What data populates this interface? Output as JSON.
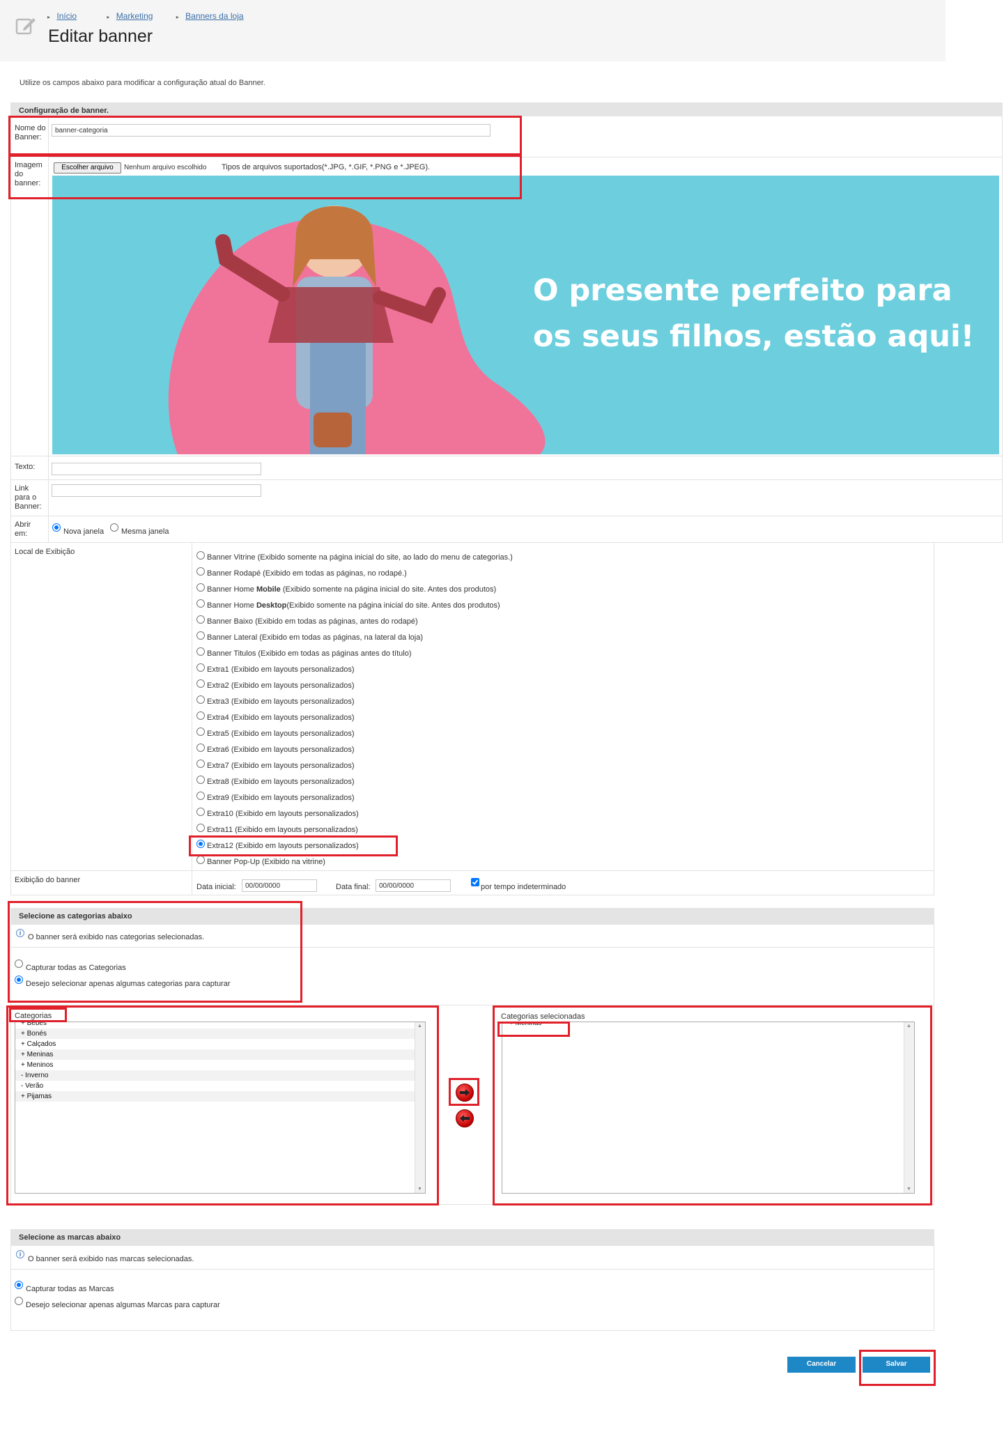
{
  "breadcrumb": [
    "Início",
    "Marketing",
    "Banners da loja"
  ],
  "page_title": "Editar banner",
  "intro": "Utilize os campos abaixo para modificar a configuração atual do Banner.",
  "config": {
    "header": "Configuração de banner.",
    "name_label": "Nome do Banner:",
    "name_value": "banner-categoria",
    "image_label": "Imagem do banner:",
    "choose_file": "Escolher arquivo",
    "no_file": "Nenhum arquivo escolhido",
    "file_types": "Tipos de arquivos suportados(*.JPG, *.GIF, *.PNG e *.JPEG).",
    "banner_headline_1": "O presente perfeito para",
    "banner_headline_2": "os seus filhos, estão aqui!",
    "text_label": "Texto:",
    "link_label": "Link para o Banner:",
    "open_label": "Abrir em:",
    "open_new": "Nova janela",
    "open_same": "Mesma janela",
    "display_label": "Local de Exibição",
    "display_options": [
      "Banner Vitrine (Exibido somente na página inicial do site, ao lado do menu de categorias.)",
      "Banner Rodapé (Exibido em todas as páginas, no rodapé.)",
      "Banner Home Mobile (Exibido somente na página inicial do site. Antes dos produtos)",
      "Banner Home Desktop(Exibido somente na página inicial do site. Antes dos produtos)",
      "Banner Baixo (Exibido em todas as páginas, antes do rodapé)",
      "Banner Lateral (Exibido em todas as páginas, na lateral da loja)",
      "Banner Titulos (Exibido em todas as páginas antes do título)",
      "Extra1 (Exibido em layouts personalizados)",
      "Extra2 (Exibido em layouts personalizados)",
      "Extra3 (Exibido em layouts personalizados)",
      "Extra4 (Exibido em layouts personalizados)",
      "Extra5 (Exibido em layouts personalizados)",
      "Extra6 (Exibido em layouts personalizados)",
      "Extra7 (Exibido em layouts personalizados)",
      "Extra8 (Exibido em layouts personalizados)",
      "Extra9 (Exibido em layouts personalizados)",
      "Extra10 (Exibido em layouts personalizados)",
      "Extra11 (Exibido em layouts personalizados)",
      "Extra12 (Exibido em layouts personalizados)",
      "Banner Pop-Up (Exibido na vitrine)"
    ],
    "display_selected_index": 18,
    "period_label": "Exibição do banner",
    "start_label": "Data inicial:",
    "start_value": "00/00/0000",
    "end_label": "Data final:",
    "end_value": "00/00/0000",
    "indefinite": "por tempo indeterminado"
  },
  "categories": {
    "header": "Selecione as categorias abaixo",
    "info": "O banner será exibido nas categorias selecionadas.",
    "all": "Capturar todas as Categorias",
    "some": "Desejo selecionar apenas algumas categorias para capturar",
    "list_label": "Categorias",
    "items": [
      "+ Bebes",
      "+ Bonés",
      "+ Calçados",
      "+ Meninas",
      "+ Meninos",
      " - Inverno",
      " - Verão",
      "+ Pijamas"
    ],
    "selected_label": "Categorias selecionadas",
    "selected_items": [
      "+ Meninas"
    ]
  },
  "brands": {
    "header": "Selecione as marcas abaixo",
    "info": "O banner será exibido nas marcas selecionadas.",
    "all": "Capturar todas as Marcas",
    "some": "Desejo selecionar apenas algumas Marcas para capturar"
  },
  "actions": {
    "cancel": "Cancelar",
    "save": "Salvar"
  },
  "colors": {
    "accent": "#1e88c7",
    "highlight": "#e0202a",
    "banner_bg": "#6dcfde",
    "banner_blob": "#f0739a"
  }
}
